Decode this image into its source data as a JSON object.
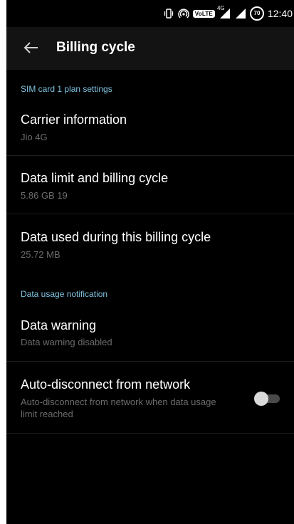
{
  "status_bar": {
    "icons": [
      "vibrate-icon",
      "hotspot-icon",
      "volte-badge-icon",
      "signal-4g-icon",
      "signal-icon",
      "battery-icon"
    ],
    "volte_label": "VoLTE",
    "network_label": "4G",
    "battery_level": "70",
    "time": "12:40"
  },
  "app_bar": {
    "back_icon": "arrow-left-icon",
    "title": "Billing cycle"
  },
  "sections": {
    "sim": {
      "header": "SIM card 1 plan settings",
      "carrier": {
        "title": "Carrier information",
        "subtitle": "Jio 4G"
      },
      "data_limit": {
        "title": "Data limit and billing cycle",
        "subtitle": "5.86 GB 19"
      },
      "data_used": {
        "title": "Data used during this billing cycle",
        "subtitle": "25.72 MB"
      }
    },
    "notification": {
      "header": "Data usage notification",
      "warning": {
        "title": "Data warning",
        "subtitle": "Data warning disabled"
      },
      "auto_disconnect": {
        "title": "Auto-disconnect from network",
        "subtitle": "Auto-disconnect from network when data usage limit reached",
        "enabled": false
      }
    }
  },
  "colors": {
    "background": "#000000",
    "app_bar": "#131313",
    "section_header": "#7fc4e0",
    "secondary_text": "#6c6c6c"
  }
}
